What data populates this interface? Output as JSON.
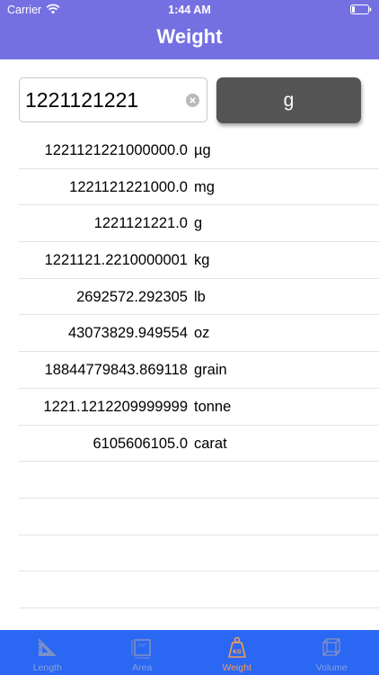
{
  "status_bar": {
    "carrier": "Carrier",
    "time": "1:44 AM"
  },
  "header": {
    "title": "Weight"
  },
  "input": {
    "value": "1221121221"
  },
  "unit_button": {
    "label": "g"
  },
  "results": [
    {
      "value": "1221121221000000.0",
      "unit": "µg"
    },
    {
      "value": "1221121221000.0",
      "unit": "mg"
    },
    {
      "value": "1221121221.0",
      "unit": "g"
    },
    {
      "value": "1221121.2210000001",
      "unit": "kg"
    },
    {
      "value": "2692572.292305",
      "unit": "lb"
    },
    {
      "value": "43073829.949554",
      "unit": "oz"
    },
    {
      "value": "18844779843.869118",
      "unit": "grain"
    },
    {
      "value": "1221.1212209999999",
      "unit": "tonne"
    },
    {
      "value": "6105606105.0",
      "unit": "carat"
    }
  ],
  "tabs": [
    {
      "label": "Length",
      "icon": "ruler-triangle-icon"
    },
    {
      "label": "Area",
      "icon": "area-square-icon"
    },
    {
      "label": "Weight",
      "icon": "weight-kg-icon",
      "active": true
    },
    {
      "label": "Volume",
      "icon": "cube-icon"
    }
  ],
  "colors": {
    "header": "#7570e2",
    "tab_bar": "#2a67f2",
    "active_tab": "#f29c55",
    "unit_button": "#555555"
  }
}
